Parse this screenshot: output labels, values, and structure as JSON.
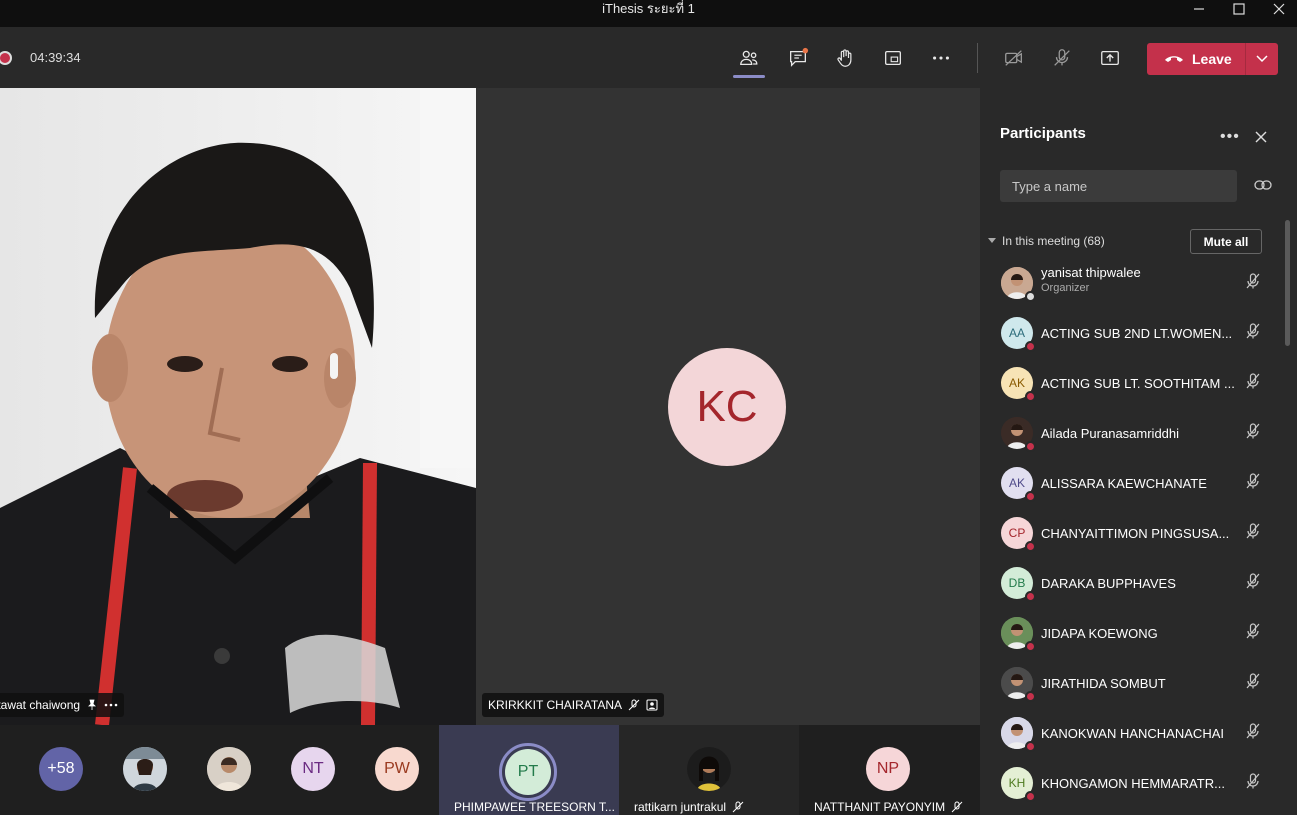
{
  "window": {
    "title": "iThesis ระยะที่ 1"
  },
  "toolbar": {
    "timer": "04:39:34",
    "leave_label": "Leave"
  },
  "stage": {
    "main_video_name": "ttawat chaiwong",
    "kc_initials": "KC",
    "kc_name": "KRIRKKIT CHAIRATANA"
  },
  "strip": {
    "overflow": "+58",
    "nt": "NT",
    "pw": "PW",
    "pt": "PT",
    "pt_name": "PHIMPAWEE TREESORN T...",
    "rattikarn_name": "rattikarn juntrakul",
    "np": "NP",
    "np_name": "NATTHANIT PAYONYIM"
  },
  "panel": {
    "title": "Participants",
    "search_placeholder": "Type a name",
    "section_label": "In this meeting (68)",
    "mute_all": "Mute all",
    "participants": [
      {
        "name": "yanisat thipwalee",
        "role": "Organizer",
        "initials": "",
        "photo": true
      },
      {
        "name": "ACTING SUB 2ND LT.WOMEN...",
        "initials": "AA",
        "bg": "#cfe8ec",
        "fg": "#2b6b7a"
      },
      {
        "name": "ACTING SUB LT. SOOTHITAM ...",
        "initials": "AK",
        "bg": "#f7e3b5",
        "fg": "#8a5a00"
      },
      {
        "name": "Ailada Puranasamriddhi",
        "initials": "",
        "photo": true
      },
      {
        "name": "ALISSARA KAEWCHANATE",
        "initials": "AK",
        "bg": "#e1dff0",
        "fg": "#4f4b8a"
      },
      {
        "name": "CHANYAITTIMON PINGSUSA...",
        "initials": "CP",
        "bg": "#f6d6d8",
        "fg": "#a4262c"
      },
      {
        "name": "DARAKA BUPPHAVES",
        "initials": "DB",
        "bg": "#d3ecd8",
        "fg": "#237b4b"
      },
      {
        "name": "JIDAPA KOEWONG",
        "initials": "",
        "photo": true
      },
      {
        "name": "JIRATHIDA SOMBUT",
        "initials": "",
        "photo": true
      },
      {
        "name": "KANOKWAN HANCHANACHAI",
        "initials": "",
        "photo": true
      },
      {
        "name": "KHONGAMON HEMMARATR...",
        "initials": "KH",
        "bg": "#e4efd4",
        "fg": "#4e7a1f"
      }
    ]
  }
}
